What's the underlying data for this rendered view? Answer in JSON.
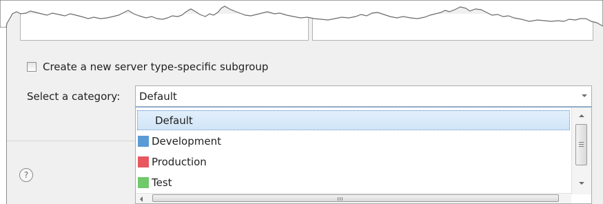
{
  "options": {
    "create_subgroup_label": "Create a new server type-specific subgroup",
    "create_subgroup_checked": false
  },
  "category": {
    "label": "Select a category:",
    "selected": "Default",
    "items": [
      {
        "label": "Default",
        "color": null,
        "selected": true
      },
      {
        "label": "Development",
        "color": "#5b9bd5"
      },
      {
        "label": "Production",
        "color": "#e8575f"
      },
      {
        "label": "Test",
        "color": "#70c96b"
      }
    ]
  },
  "help": {
    "glyph": "?"
  }
}
